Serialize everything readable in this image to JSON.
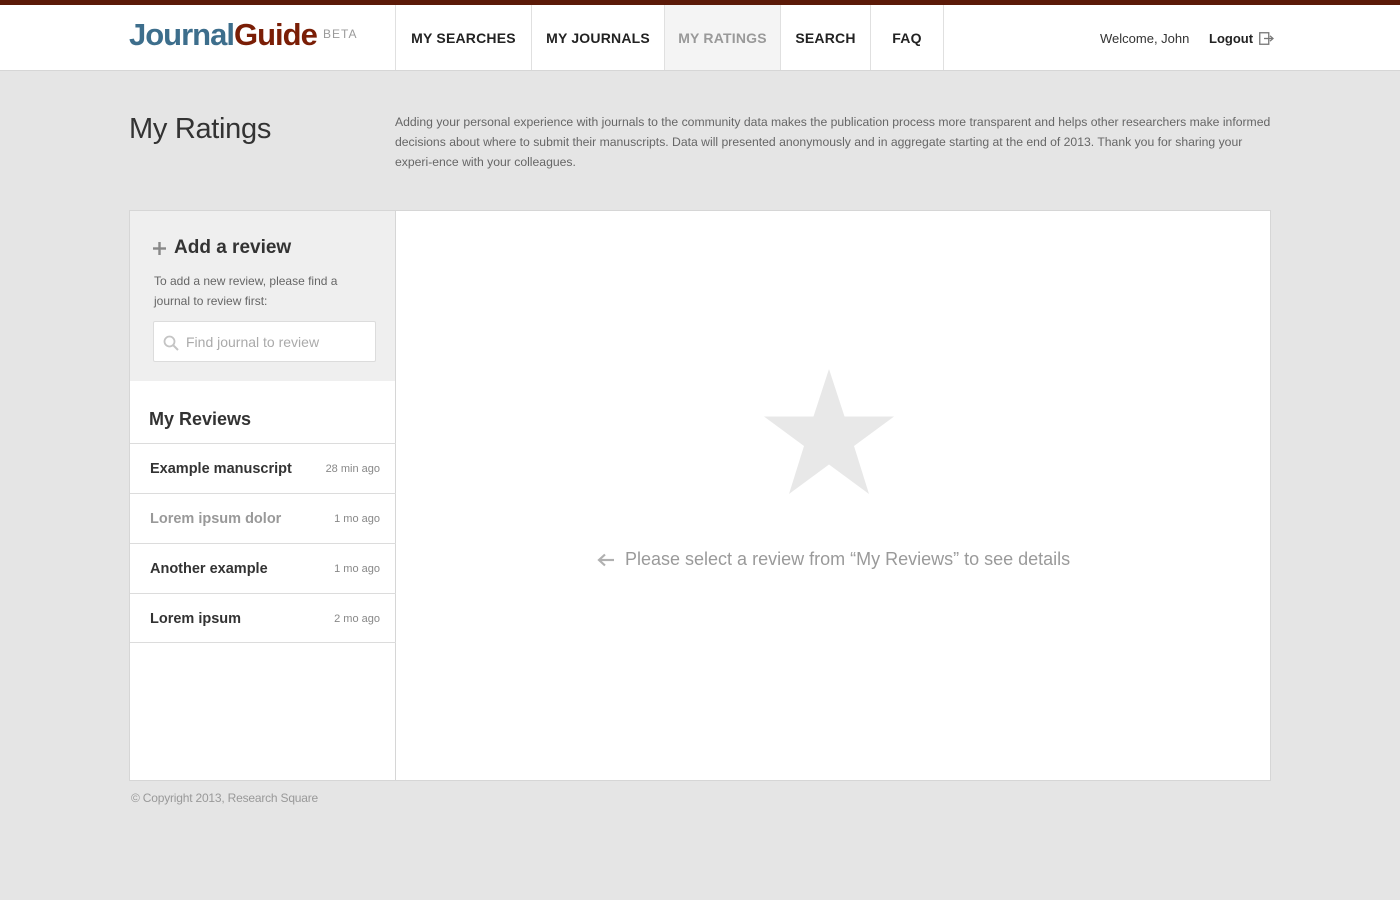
{
  "brand": {
    "part1": "Journal",
    "part2": "Guide",
    "badge": "BETA"
  },
  "nav": {
    "items": [
      {
        "label": "MY SEARCHES"
      },
      {
        "label": "MY JOURNALS"
      },
      {
        "label": "MY RATINGS",
        "active": true
      },
      {
        "label": "SEARCH"
      },
      {
        "label": "FAQ"
      }
    ]
  },
  "user": {
    "welcome": "Welcome, John",
    "logout": "Logout"
  },
  "page": {
    "title": "My Ratings",
    "intro": "Adding your personal experience with journals to the community data makes the publication process more transparent and helps other researchers make informed decisions about where to submit their manuscripts. Data will presented anonymously and in aggregate starting at the end of 2013. Thank you for sharing your experi-ence with your colleagues."
  },
  "add_review": {
    "title": "Add a review",
    "description": "To add a new review, please find a journal to review first:",
    "search_placeholder": "Find journal to review"
  },
  "my_reviews": {
    "title": "My Reviews",
    "items": [
      {
        "name": "Example manuscript",
        "time": "28 min ago"
      },
      {
        "name": "Lorem ipsum dolor",
        "time": "1 mo ago",
        "dim": true
      },
      {
        "name": "Another example",
        "time": "1 mo ago"
      },
      {
        "name": "Lorem ipsum",
        "time": "2 mo ago"
      }
    ]
  },
  "detail": {
    "hint": "Please select a review from “My Reviews” to see details"
  },
  "footer": {
    "copyright": "©  Copyright 2013, Research Square"
  },
  "colors": {
    "brand_blue": "#3d6e8c",
    "brand_red": "#7a1e06",
    "top_border": "#5b1a08",
    "background": "#e5e5e5"
  },
  "icons": {
    "logout": "logout-icon",
    "add": "plus-icon",
    "search": "search-icon",
    "empty_state": "star-icon",
    "hint": "arrow-left-icon"
  }
}
